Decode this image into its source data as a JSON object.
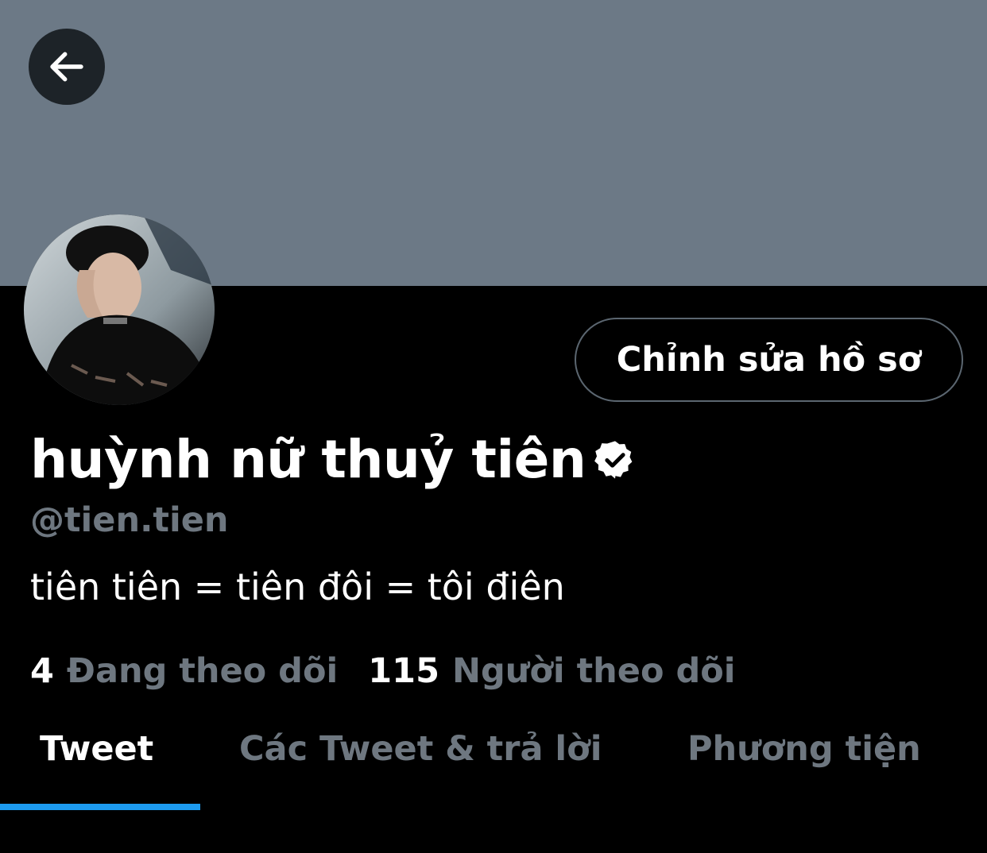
{
  "profile": {
    "display_name": "huỳnh nữ thuỷ tiên",
    "handle": "@tien.tien",
    "bio": "tiên tiên = tiên đôi = tôi điên",
    "following_count": "4",
    "following_label": "Đang theo dõi",
    "followers_count": "115",
    "followers_label": "Người theo dõi",
    "verified": true
  },
  "actions": {
    "edit_profile_label": "Chỉnh sửa hồ sơ"
  },
  "tabs": [
    {
      "label": "Tweet",
      "active": true
    },
    {
      "label": "Các Tweet & trả lời",
      "active": false
    },
    {
      "label": "Phương tiện",
      "active": false
    }
  ],
  "icons": {
    "back": "back-arrow-icon",
    "verified": "verified-badge-icon"
  },
  "colors": {
    "banner": "#6c7986",
    "background": "#000000",
    "secondary_text": "#6e7780",
    "accent": "#1d9bf0",
    "button_border": "#5b6670"
  }
}
